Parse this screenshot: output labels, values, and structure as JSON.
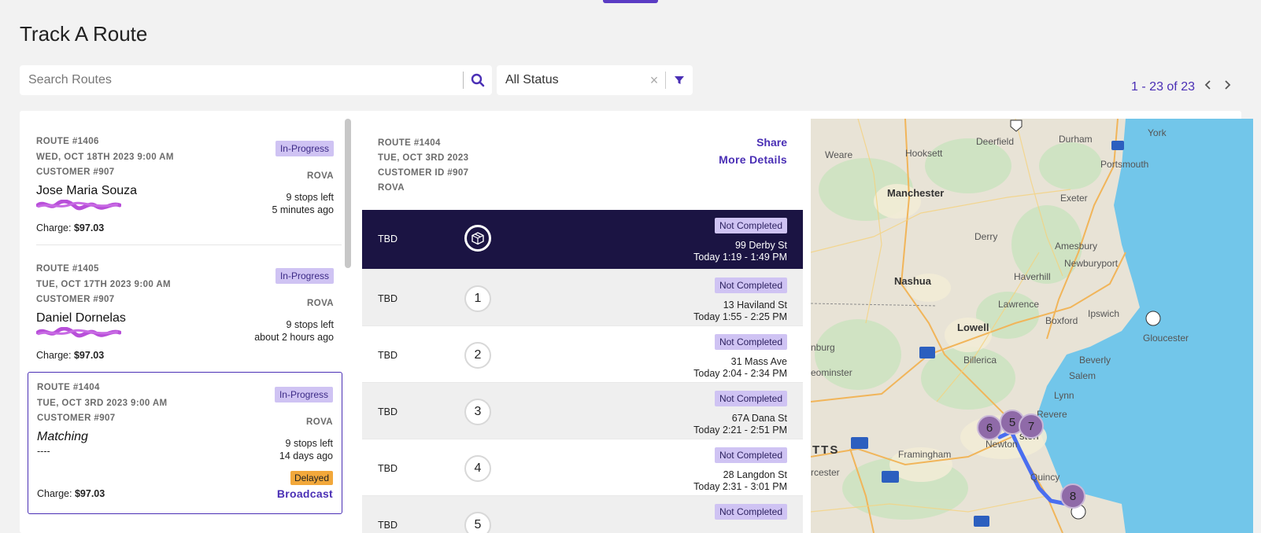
{
  "page": {
    "title": "Track A Route"
  },
  "search": {
    "placeholder": "Search Routes"
  },
  "status_filter": {
    "value": "All Status"
  },
  "pagination": {
    "text": "1 - 23 of 23"
  },
  "routes": [
    {
      "route": "ROUTE #1406",
      "date": "WED, OCT 18TH 2023 9:00 AM",
      "customer": "CUSTOMER #907",
      "status": "In-Progress",
      "company": "ROVA",
      "name": "Jose Maria Souza",
      "stops_left": "9 stops left",
      "time_ago": "5 minutes ago",
      "charge_label": "Charge:",
      "charge": "$97.03"
    },
    {
      "route": "ROUTE #1405",
      "date": "TUE, OCT 17TH 2023 9:00 AM",
      "customer": "CUSTOMER #907",
      "status": "In-Progress",
      "company": "ROVA",
      "name": "Daniel Dornelas",
      "stops_left": "9 stops left",
      "time_ago": "about 2 hours ago",
      "charge_label": "Charge:",
      "charge": "$97.03"
    },
    {
      "route": "ROUTE #1404",
      "date": "TUE, OCT 3RD 2023 9:00 AM",
      "customer": "CUSTOMER #907",
      "status": "In-Progress",
      "company": "ROVA",
      "name": "Matching",
      "phone": "----",
      "stops_left": "9 stops left",
      "time_ago": "14 days ago",
      "delay": "Delayed",
      "broadcast": "Broadcast",
      "charge_label": "Charge:",
      "charge": "$97.03"
    }
  ],
  "detail": {
    "route": "ROUTE #1404",
    "date": "TUE, OCT 3RD 2023",
    "customer_id": "CUSTOMER ID #907",
    "company": "ROVA",
    "share": "Share",
    "more_details": "More Details",
    "stops": [
      {
        "label": "TBD",
        "marker": "",
        "status": "Not Completed",
        "address": "99 Derby St",
        "window": "Today 1:19 - 1:49 PM"
      },
      {
        "label": "TBD",
        "marker": "1",
        "status": "Not Completed",
        "address": "13 Haviland St",
        "window": "Today 1:55 - 2:25 PM"
      },
      {
        "label": "TBD",
        "marker": "2",
        "status": "Not Completed",
        "address": "31 Mass Ave",
        "window": "Today 2:04 - 2:34 PM"
      },
      {
        "label": "TBD",
        "marker": "3",
        "status": "Not Completed",
        "address": "67A Dana St",
        "window": "Today 2:21 - 2:51 PM"
      },
      {
        "label": "TBD",
        "marker": "4",
        "status": "Not Completed",
        "address": "28 Langdon St",
        "window": "Today 2:31 - 3:01 PM"
      },
      {
        "label": "TBD",
        "marker": "5",
        "status": "Not Completed",
        "address": "",
        "window": ""
      }
    ]
  },
  "map": {
    "places": [
      "York",
      "Weare",
      "Hooksett",
      "Deerfield",
      "Durham",
      "Portsmouth",
      "Manchester",
      "Exeter",
      "Derry",
      "Amesbury",
      "Newburyport",
      "Nashua",
      "Haverhill",
      "Lawrence",
      "Ipswich",
      "Boxford",
      "Lowell",
      "Gloucester",
      "Billerica",
      "Beverly",
      "Salem",
      "Lynn",
      "Framingham",
      "Newton",
      "Quincy",
      "TTS",
      "rcester",
      "eominster",
      "nburg",
      "Revere",
      "ston"
    ],
    "markers": [
      "6",
      "5",
      "7",
      "8"
    ],
    "route_color": "#4a6ef0",
    "marker_color": "#8f6aa8"
  }
}
